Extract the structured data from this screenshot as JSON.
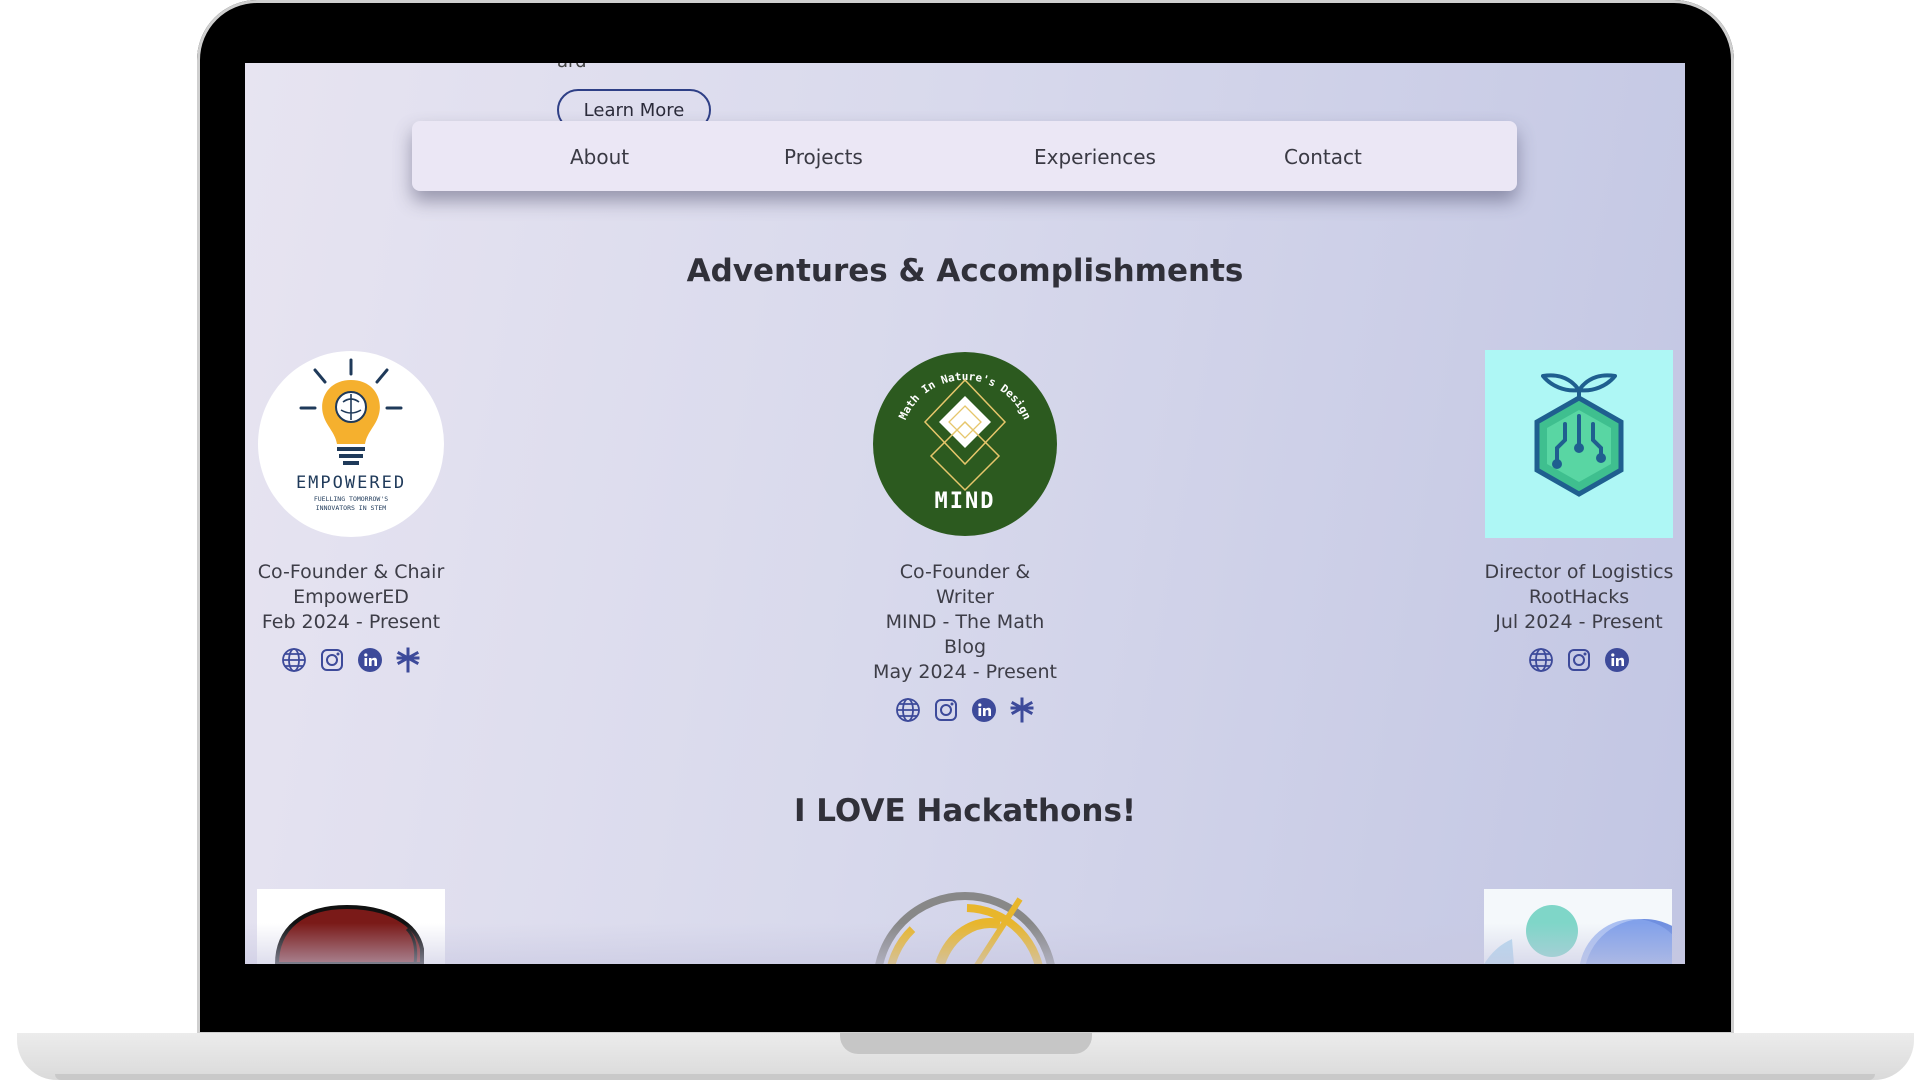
{
  "nav": {
    "items": [
      {
        "label": "About"
      },
      {
        "label": "Projects"
      },
      {
        "label": "Experiences"
      },
      {
        "label": "Contact"
      }
    ]
  },
  "hero": {
    "cut_text": "ard",
    "learn_more_label": "Learn More"
  },
  "accomplishments": {
    "title": "Adventures & Accomplishments",
    "cards": [
      {
        "role": "Co-Founder & Chair",
        "org": "EmpowerED",
        "dates": "Feb 2024 - Present",
        "logo_text": "EMPOWERED",
        "logo_subtext_1": "FUELLING TOMORROW'S",
        "logo_subtext_2": "INNOVATORS IN STEM",
        "icons": [
          "globe-icon",
          "instagram-icon",
          "linkedin-icon",
          "linktree-icon"
        ]
      },
      {
        "role": "Co-Founder & Writer",
        "org": "MIND - The Math Blog",
        "dates": "May 2024 - Present",
        "logo_text": "MIND",
        "logo_arc_text": "Math In Nature's Design",
        "icons": [
          "globe-icon",
          "instagram-icon",
          "linkedin-icon",
          "linktree-icon"
        ]
      },
      {
        "role": "Director of Logistics",
        "org": "RootHacks",
        "dates": "Jul 2024 - Present",
        "icons": [
          "globe-icon",
          "instagram-icon",
          "linkedin-icon"
        ]
      }
    ]
  },
  "hackathons": {
    "title": "I LOVE Hackathons!"
  },
  "colors": {
    "icon": "#3d4a9a",
    "accent": "#2e3f86",
    "mind_green": "#2c5a1f",
    "roothacks_bg": "#aef7f5"
  }
}
